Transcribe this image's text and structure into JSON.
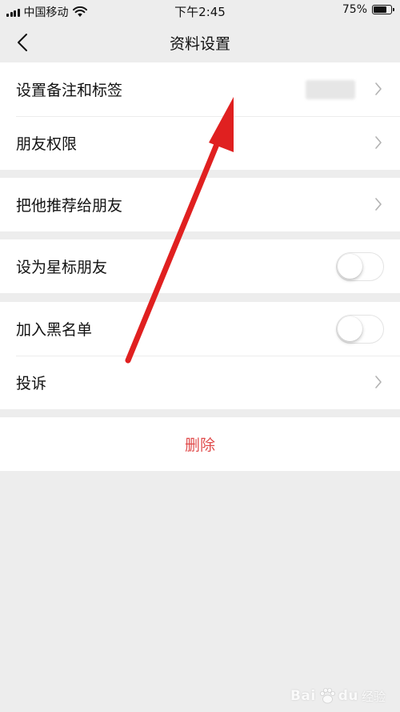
{
  "status_bar": {
    "carrier": "中国移动",
    "time": "下午2:45",
    "battery_percent": "75%",
    "battery_level": 0.75
  },
  "nav": {
    "back_icon": "chevron-left-icon",
    "title": "资料设置"
  },
  "settings": {
    "remarks_label": "设置备注和标签",
    "permissions_label": "朋友权限",
    "recommend_label": "把他推荐给朋友",
    "star_label": "设为星标朋友",
    "star_on": false,
    "blacklist_label": "加入黑名单",
    "blacklist_on": false,
    "complain_label": "投诉",
    "delete_label": "删除"
  },
  "colors": {
    "background": "#ededed",
    "cell": "#ffffff",
    "delete_text": "#e04b4b",
    "arrow": "#e02020"
  },
  "watermark": {
    "brand": "Bai",
    "brand_suffix": "du",
    "sub": "经验"
  }
}
